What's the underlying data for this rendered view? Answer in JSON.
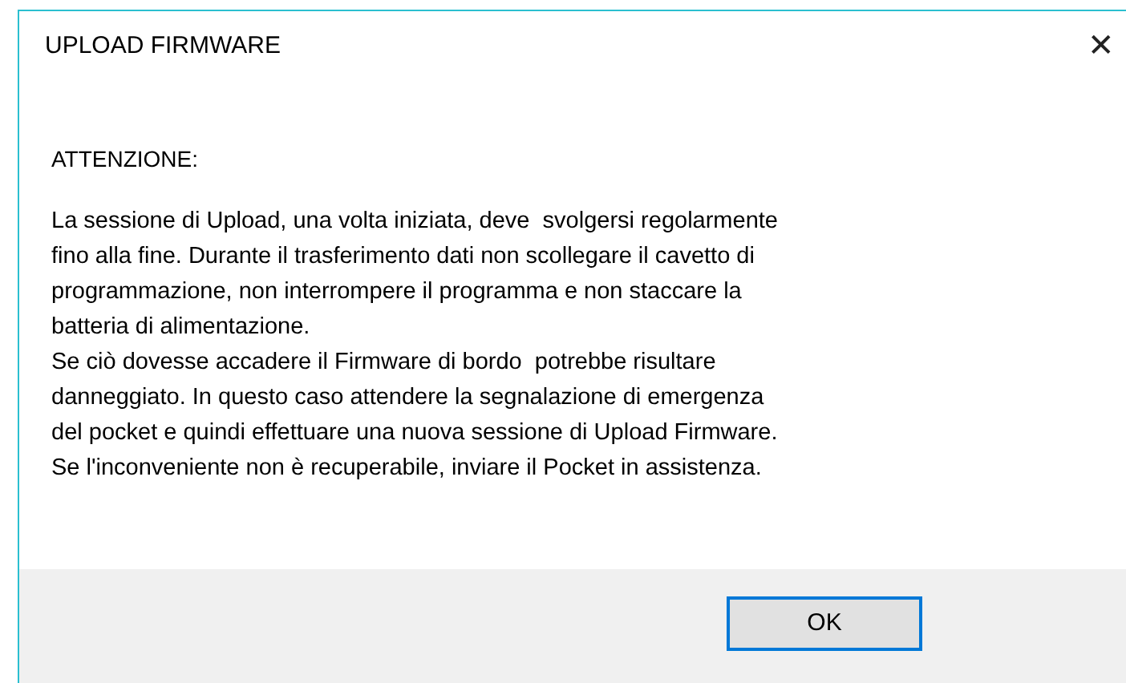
{
  "window": {
    "title": "UPLOAD FIRMWARE",
    "close": "✕"
  },
  "heading": "ATTENZIONE:",
  "message_lines": [
    "La sessione di Upload, una volta iniziata, deve  svolgersi regolarmente",
    "fino alla fine. Durante il trasferimento dati non scollegare il cavetto di",
    "programmazione, non interrompere il programma e non staccare la",
    "batteria di alimentazione.",
    "Se ciò dovesse accadere il Firmware di bordo  potrebbe risultare",
    "danneggiato. In questo caso attendere la segnalazione di emergenza",
    "del pocket e quindi effettuare una nuova sessione di Upload Firmware.",
    "Se l'inconveniente non è recuperabile, inviare il Pocket in assistenza."
  ],
  "buttons": [
    "OK"
  ]
}
